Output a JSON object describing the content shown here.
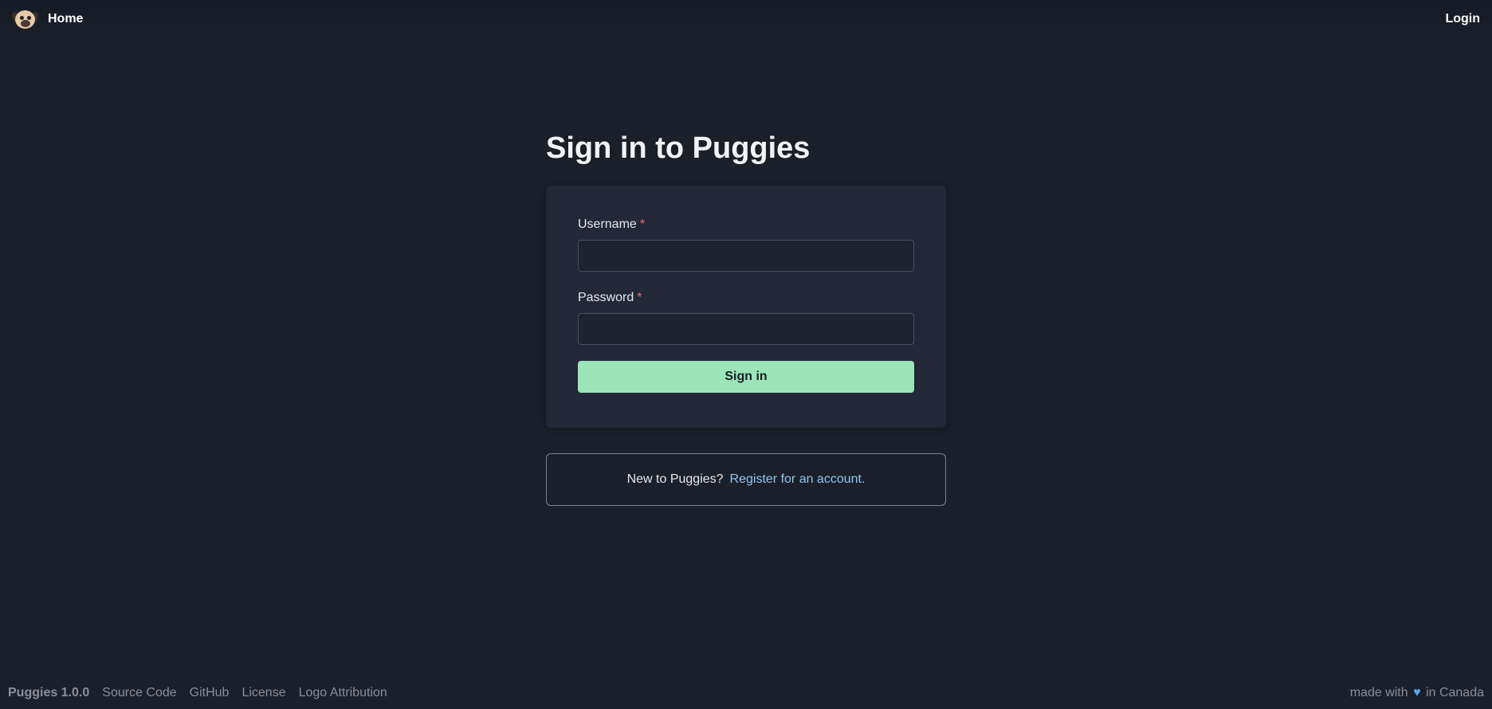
{
  "header": {
    "home_label": "Home",
    "login_label": "Login"
  },
  "page": {
    "title": "Sign in to Puggies"
  },
  "form": {
    "username_label": "Username",
    "username_value": "",
    "password_label": "Password",
    "password_value": "",
    "required_marker": "*",
    "submit_label": "Sign in",
    "accent_color": "#9be5b8"
  },
  "register": {
    "prompt": "New to Puggies?",
    "link_label": "Register for an account."
  },
  "footer": {
    "version": "Puggies 1.0.0",
    "links": [
      "Source Code",
      "GitHub",
      "License",
      "Logo Attribution"
    ],
    "made_with_prefix": "made with",
    "heart_icon": "heart-icon",
    "made_with_suffix": "in Canada"
  }
}
